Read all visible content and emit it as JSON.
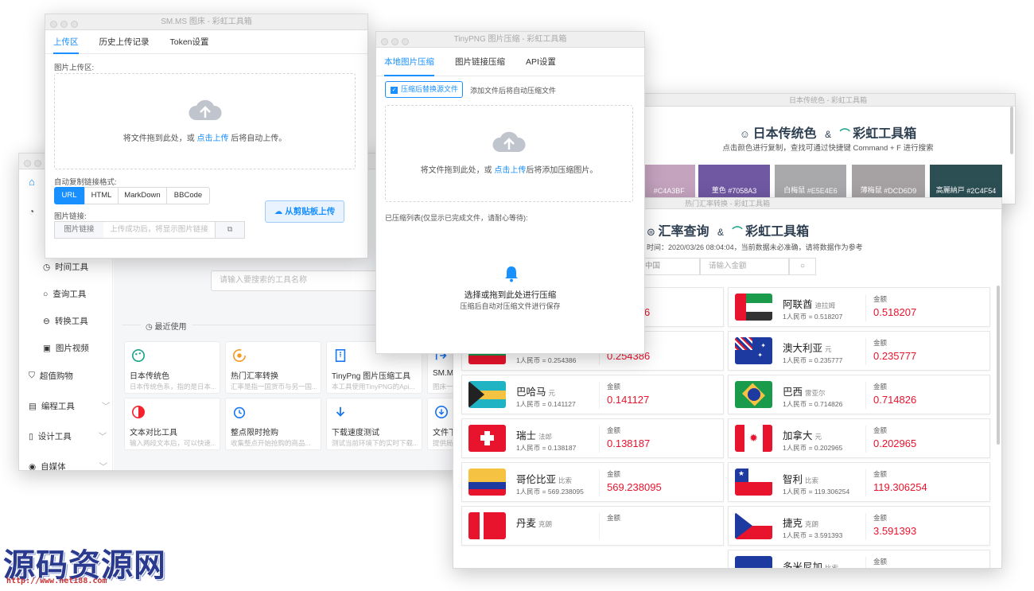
{
  "main_window": {
    "sidebar": [
      {
        "label": "时间工具",
        "icon": "clock-icon"
      },
      {
        "label": "查询工具",
        "icon": "search-icon"
      },
      {
        "label": "转换工具",
        "icon": "convert-icon"
      },
      {
        "label": "图片视频",
        "icon": "image-icon"
      },
      {
        "label": "超值购物",
        "icon": "cart-icon"
      },
      {
        "label": "编程工具",
        "icon": "code-icon"
      },
      {
        "label": "设计工具",
        "icon": "design-icon"
      },
      {
        "label": "自媒体",
        "icon": "media-icon"
      }
    ],
    "search_placeholder": "请输入要搜索的工具名称",
    "recent_label": "最近使用",
    "cards": [
      {
        "title": "日本传统色",
        "desc": "日本传统色系，指的是日本...",
        "icon": "palette-icon",
        "color": "#19a38a"
      },
      {
        "title": "热门汇率转换",
        "desc": "汇率是指一国货币与另一国...",
        "icon": "exchange-icon",
        "color": "#f59a23"
      },
      {
        "title": "TinyPng 图片压缩工具",
        "desc": "本工具使用TinyPNG的Api...",
        "icon": "zip-icon",
        "color": "#1877f2"
      },
      {
        "title": "SM.MS",
        "desc": "图床一",
        "icon": "upload-icon",
        "color": "#1877f2"
      },
      {
        "title": "文本对比工具",
        "desc": "输入两段文本后，可以快速...",
        "icon": "compare-icon",
        "color": "#f5222d"
      },
      {
        "title": "整点限时抢购",
        "desc": "收集整点开始抢购的商品...",
        "icon": "alarm-icon",
        "color": "#1877f2"
      },
      {
        "title": "下载速度测试",
        "desc": "测试当前环境下的实时下载...",
        "icon": "download-icon",
        "color": "#1877f2"
      },
      {
        "title": "文件下",
        "desc": "提供局",
        "icon": "download-circle-icon",
        "color": "#1877f2"
      }
    ]
  },
  "smms_window": {
    "title": "SM.MS 图床 - 彩虹工具箱",
    "tabs": [
      "上传区",
      "历史上传记录",
      "Token设置"
    ],
    "upload_area_label": "图片上传区:",
    "drop_text_before": "将文件拖到此处，或",
    "drop_link": "点击上传",
    "drop_text_after": "后将自动上传。",
    "format_label": "自动复制链接格式:",
    "formats": [
      "URL",
      "HTML",
      "MarkDown",
      "BBCode"
    ],
    "link_label": "图片链接:",
    "link_prefix": "图片链接",
    "link_placeholder": "上传成功后，将显示图片链接",
    "paste_button": "从剪贴板上传"
  },
  "tiny_window": {
    "title": "TinyPNG 图片压缩 - 彩虹工具箱",
    "tabs": [
      "本地图片压缩",
      "图片链接压缩",
      "API设置"
    ],
    "replace_checkbox": "压缩后替换源文件",
    "auto_hint": "添加文件后将自动压缩文件",
    "drop_text_before": "将文件拖到此处，或",
    "drop_link": "点击上传",
    "drop_text_after": "后将添加压缩图片。",
    "list_label": "已压缩列表(仅显示已完成文件，请耐心等待):",
    "empty_title": "选择或拖到此处进行压缩",
    "empty_sub": "压缩后自动对压缩文件进行保存"
  },
  "color_window": {
    "title": "日本传统色 - 彩虹工具箱",
    "heading_a": "日本传统色",
    "amp": "&",
    "heading_b": "彩虹工具箱",
    "sub": "点击颜色进行复制，查找可通过快捷键 Command + F 进行搜索",
    "swatches": [
      {
        "name": "",
        "hex": "#C4A3BF",
        "color": "#c4a3bf"
      },
      {
        "name": "菫色",
        "hex": "#7058A3",
        "color": "#7058a3"
      },
      {
        "name": "白梅鼠",
        "hex": "#E5E4E6",
        "color": "#a9a8aa"
      },
      {
        "name": "薄梅鼠",
        "hex": "#DCD6D9",
        "color": "#a6a2a4"
      },
      {
        "name": "高麗納戸",
        "hex": "#2C4F54",
        "color": "#2c4f54"
      }
    ]
  },
  "rate_window": {
    "title": "热门汇率转换 - 彩虹工具箱",
    "heading_a": "汇率查询",
    "amp": "&",
    "heading_b": "彩虹工具箱",
    "sub_prefix": "时间：",
    "sub_time": "2020/03/26 08:04:04",
    "sub_note": "，当前数据未必准确，请将数据作为参考",
    "currency_value": "中国",
    "amount_placeholder": "请输入金额",
    "amount_label": "金额",
    "rows": [
      [
        {
          "name": "",
          "unit": "",
          "rate": "1人民币 = 9.001506",
          "value": "9.001506",
          "flag": "flag-partial"
        },
        {
          "name": "阿联酋",
          "unit": "迪拉姆",
          "rate": "1人民币 = 0.518207",
          "value": "0.518207",
          "flag": "flag-uae"
        }
      ],
      [
        {
          "name": "保加利亚",
          "unit": "利瓦",
          "rate": "1人民币 = 0.254386",
          "value": "0.254386",
          "flag": "flag-bulgaria"
        },
        {
          "name": "澳大利亚",
          "unit": "元",
          "rate": "1人民币 = 0.235777",
          "value": "0.235777",
          "flag": "flag-australia"
        }
      ],
      [
        {
          "name": "巴哈马",
          "unit": "元",
          "rate": "1人民币 = 0.141127",
          "value": "0.141127",
          "flag": "flag-bahamas"
        },
        {
          "name": "巴西",
          "unit": "雷亚尔",
          "rate": "1人民币 = 0.714826",
          "value": "0.714826",
          "flag": "flag-brazil"
        }
      ],
      [
        {
          "name": "瑞士",
          "unit": "法郎",
          "rate": "1人民币 = 0.138187",
          "value": "0.138187",
          "flag": "flag-switzerland"
        },
        {
          "name": "加拿大",
          "unit": "元",
          "rate": "1人民币 = 0.202965",
          "value": "0.202965",
          "flag": "flag-canada"
        }
      ],
      [
        {
          "name": "哥伦比亚",
          "unit": "比索",
          "rate": "1人民币 = 569.238095",
          "value": "569.238095",
          "flag": "flag-colombia"
        },
        {
          "name": "智利",
          "unit": "比索",
          "rate": "1人民币 = 119.306254",
          "value": "119.306254",
          "flag": "flag-chile"
        }
      ],
      [
        {
          "name": "丹麦",
          "unit": "克朗",
          "rate": "",
          "value": "",
          "flag": "flag-denmark"
        },
        {
          "name": "捷克",
          "unit": "克朗",
          "rate": "1人民币 = 3.591393",
          "value": "3.591393",
          "flag": "flag-czech"
        }
      ]
    ],
    "extra": {
      "name": "多米尼加",
      "unit": "比索",
      "flag": "flag-dominican"
    }
  },
  "watermark": {
    "text": "源码资源网",
    "url": "http://www.net188.com"
  },
  "accent": "#1890ff"
}
